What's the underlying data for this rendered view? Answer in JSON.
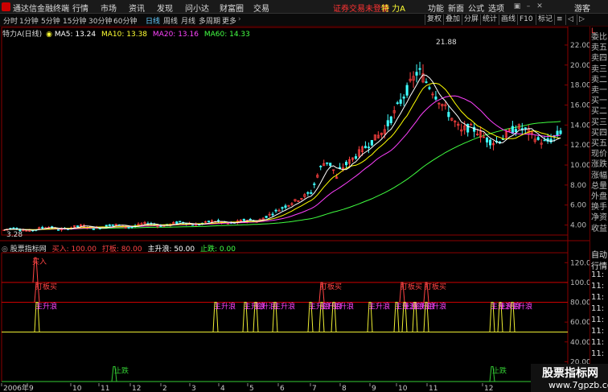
{
  "menu": {
    "app_title": "通达信金融终端",
    "items": [
      "行情",
      "市场",
      "资讯",
      "发现",
      "问小达",
      "财富圈",
      "交易"
    ],
    "login_status": "证券交易未登录",
    "stock_name": "特 力A",
    "right_items": [
      "功能",
      "新面",
      "公式",
      "选项"
    ],
    "guest": "游客"
  },
  "toolbar": {
    "periods": [
      "分时",
      "1分钟",
      "5分钟",
      "15分钟",
      "30分钟",
      "60分钟",
      "日线",
      "周线",
      "月线",
      "多周期",
      "更多"
    ],
    "active_period": "日线",
    "right_buttons": [
      "复权",
      "叠加",
      "分屏",
      "统计",
      "画线",
      "F10",
      "标记"
    ]
  },
  "main_chart": {
    "stock_label": "特力A",
    "period_tag": "(日线)",
    "ma5": "MA5: 13.24",
    "ma10": "MA10: 13.38",
    "ma20": "MA20: 13.16",
    "ma60": "MA60: 14.33",
    "y_ticks": [
      "22.00",
      "20.00",
      "18.00",
      "16.00",
      "14.00",
      "12.00",
      "10.00",
      "8.00",
      "6.00",
      "4.00"
    ],
    "high_label": "21.88",
    "low_label": "3.28"
  },
  "sub_chart": {
    "title": "股票指标网",
    "legend": [
      {
        "text": "买入: 100.00",
        "color": "#ff4040"
      },
      {
        "text": "打板: 80.00",
        "color": "#ff4040"
      },
      {
        "text": "主升浪: 50.00",
        "color": "#ffffff"
      },
      {
        "text": "止跌: 0.00",
        "color": "#40ff40"
      }
    ],
    "y_ticks": [
      "120.00",
      "100.00",
      "80.00",
      "60.00",
      "40.00",
      "20.00"
    ],
    "signal_labels": {
      "buy": "买入",
      "limit": "打板买",
      "trend": "主升浪",
      "stop": "止跌"
    }
  },
  "x_axis": {
    "labels": [
      "2006年",
      "9",
      "10",
      "11",
      "12",
      "2",
      "3",
      "4",
      "5",
      "6",
      "7",
      "8",
      "9",
      "10",
      "11",
      "12"
    ]
  },
  "right_panel": {
    "items": [
      "委比",
      "卖五",
      "卖四",
      "卖三",
      "卖二",
      "卖一",
      "买一",
      "买二",
      "买三",
      "买四",
      "买五",
      "现价",
      "涨跌",
      "涨幅",
      "总量",
      "外盘",
      "换手",
      "净资",
      "收益"
    ],
    "bottom_items": [
      "自动",
      "行情",
      "11:",
      "11:",
      "11:",
      "11:",
      "11:",
      "11:",
      "11:",
      "11:"
    ],
    "top_label": "L"
  },
  "watermark": {
    "line1": "股票指标网",
    "line2": "www.7gpzb.com"
  },
  "colors": {
    "ma5": "#ffffff",
    "ma10": "#ffff00",
    "ma20": "#ff40ff",
    "ma60": "#40ff40",
    "up": "#ff4040",
    "down": "#40ffff",
    "grid": "#8b0000"
  }
}
